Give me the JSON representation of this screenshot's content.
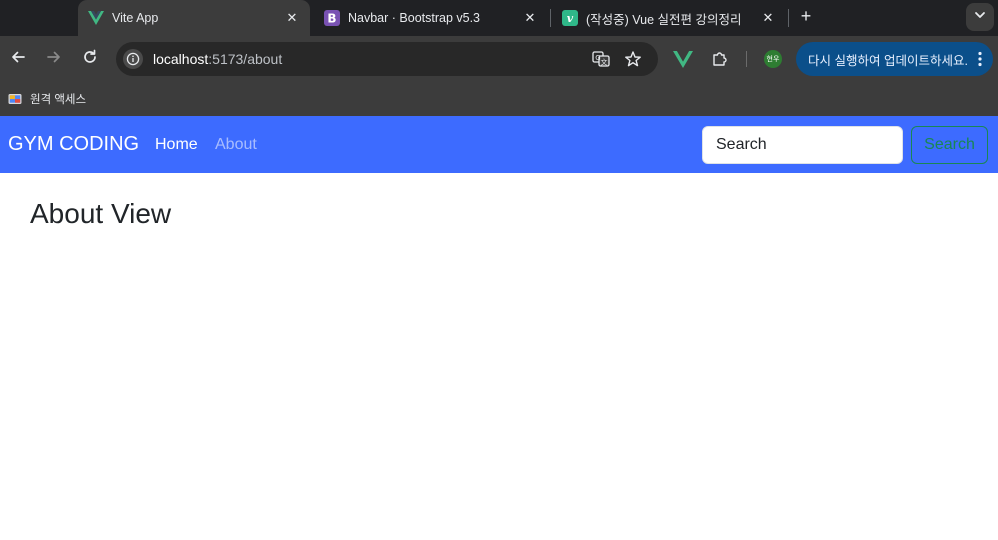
{
  "browser": {
    "tabs": [
      {
        "title": "Vite App",
        "icon": "vue-logo-icon",
        "active": true
      },
      {
        "title": "Navbar · Bootstrap v5.3",
        "icon": "bootstrap-logo-icon",
        "active": false
      },
      {
        "title": "(작성중) Vue 실전편 강의정리",
        "icon": "vue-book-icon",
        "active": false
      }
    ],
    "address": {
      "host": "localhost",
      "path": ":5173/about"
    },
    "profile_initials": "현우",
    "update_label": "다시 실행하여 업데이트하세요.",
    "bookmarks": [
      {
        "label": "원격 액세스",
        "icon": "remote-access-icon"
      }
    ],
    "colors": {
      "tab_strip": "#202124",
      "toolbar": "#3c3c3c",
      "update_button": "#0b4f8a"
    }
  },
  "page": {
    "navbar": {
      "brand": "GYM CODING",
      "links": [
        {
          "label": "Home",
          "active": true
        },
        {
          "label": "About",
          "active": false
        }
      ],
      "search_placeholder": "Search",
      "search_button": "Search",
      "colors": {
        "background": "#3d6bff",
        "search_button": "#198754"
      }
    },
    "heading": "About View"
  }
}
